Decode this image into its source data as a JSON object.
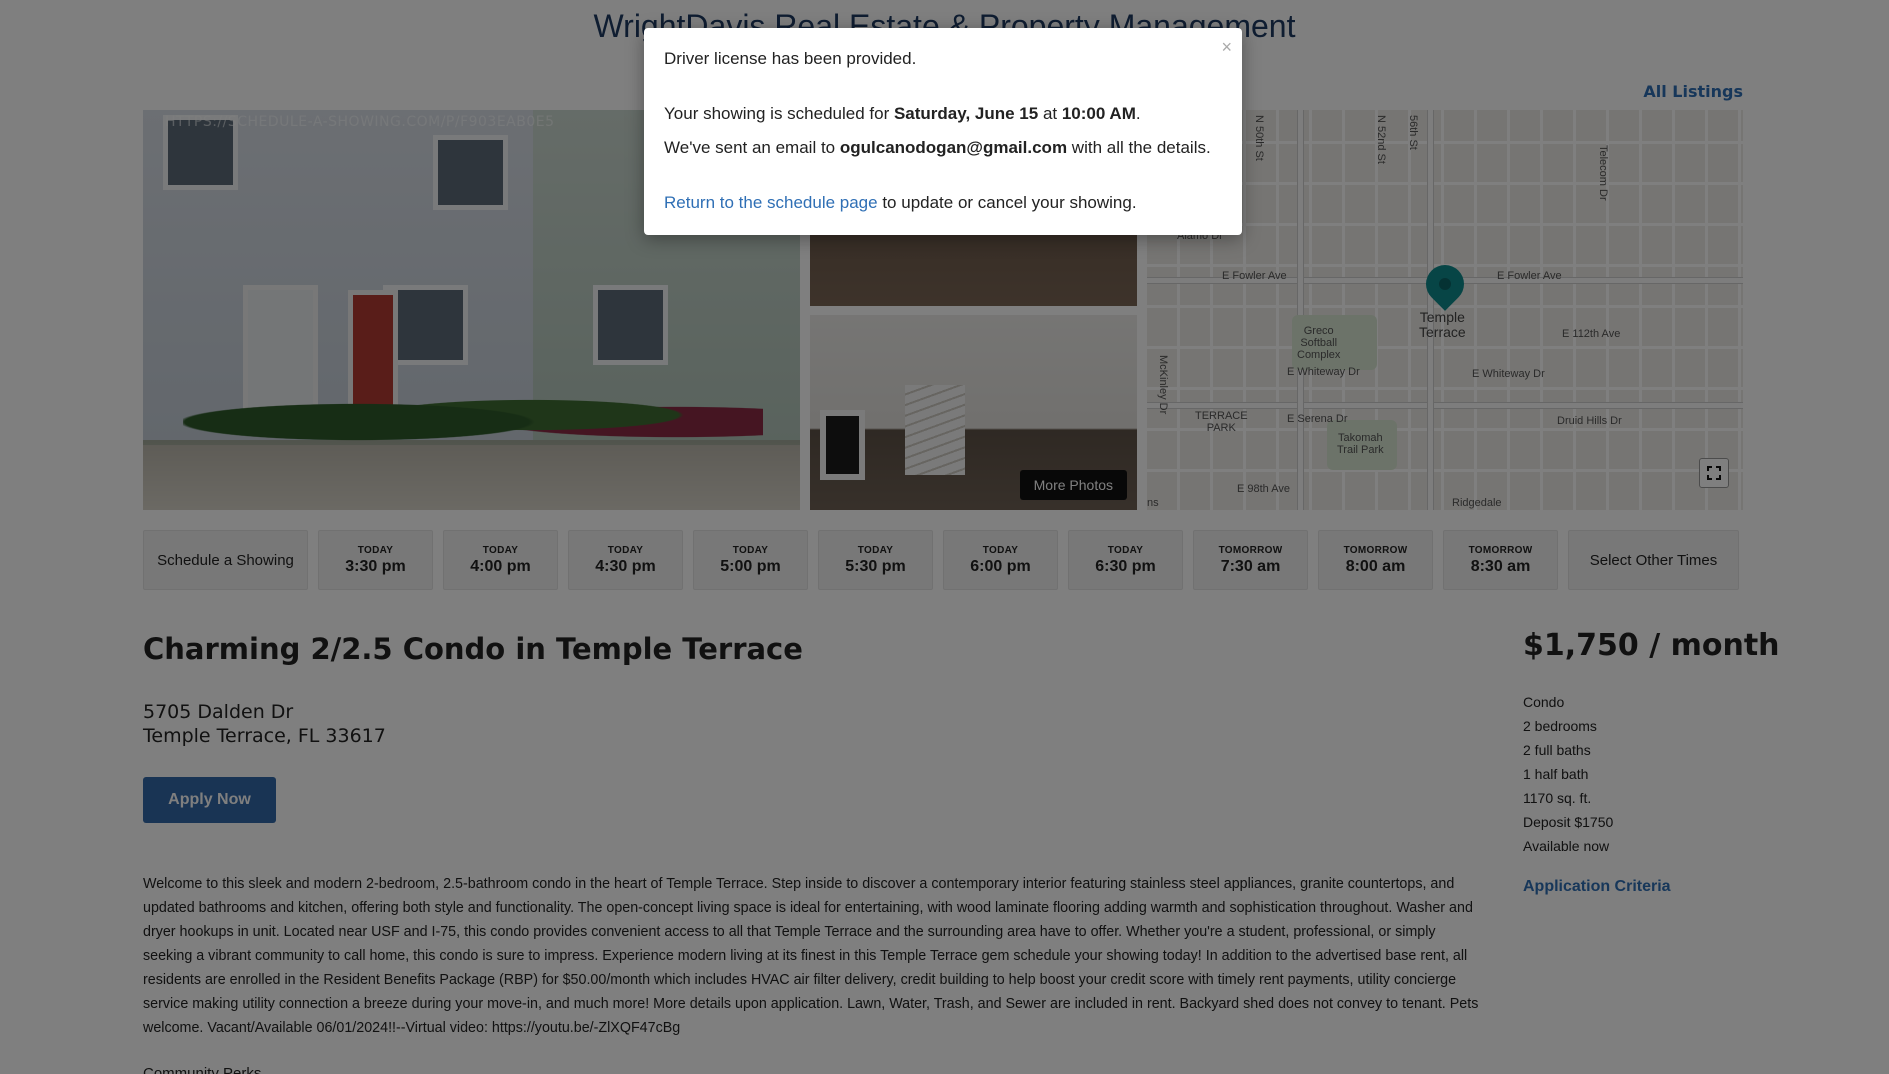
{
  "site": {
    "title": "WrightDavis Real Estate & Property Management",
    "all_listings": "All Listings"
  },
  "gallery": {
    "url_overlay": "HTTPS://SCHEDULE-A-SHOWING.COM/P/F903EAB0E5",
    "more_photos": "More Photos"
  },
  "map": {
    "labels": {
      "fowler_w": "E Fowler Ave",
      "fowler_e": "E Fowler Ave",
      "city": "Temple\nTerrace",
      "greco": "Greco\nSoftball\nComplex",
      "whiteway_w": "E Whiteway Dr",
      "whiteway_e": "E Whiteway Dr",
      "terrace_park": "TERRACE\nPARK",
      "serena": "E Serena Dr",
      "takomah": "Takomah\nTrail Park",
      "druid": "Druid Hills Dr",
      "ave98": "E 98th Ave",
      "ridgedale": "Ridgedale",
      "ave112": "E 112th Ave",
      "st56": "56th St",
      "st50": "N 50th St",
      "st52": "N 52nd St",
      "alamo": "Alamo Dr",
      "mckinley": "McKinley Dr",
      "telecom": "Telecom Dr",
      "ns": "ns"
    }
  },
  "times": {
    "schedule_label": "Schedule a Showing",
    "slots": [
      {
        "day": "TODAY",
        "time": "3:30 pm"
      },
      {
        "day": "TODAY",
        "time": "4:00 pm"
      },
      {
        "day": "TODAY",
        "time": "4:30 pm"
      },
      {
        "day": "TODAY",
        "time": "5:00 pm"
      },
      {
        "day": "TODAY",
        "time": "5:30 pm"
      },
      {
        "day": "TODAY",
        "time": "6:00 pm"
      },
      {
        "day": "TODAY",
        "time": "6:30 pm"
      },
      {
        "day": "TOMORROW",
        "time": "7:30 am"
      },
      {
        "day": "TOMORROW",
        "time": "8:00 am"
      },
      {
        "day": "TOMORROW",
        "time": "8:30 am"
      }
    ],
    "other_label": "Select Other Times"
  },
  "listing": {
    "title": "Charming 2/2.5 Condo in Temple Terrace",
    "address_line1": "5705 Dalden Dr",
    "address_line2": "Temple Terrace, FL 33617",
    "apply_label": "Apply Now",
    "description": "Welcome to this sleek and modern 2-bedroom, 2.5-bathroom condo in the heart of Temple Terrace. Step inside to discover a contemporary interior featuring stainless steel appliances, granite countertops, and updated bathrooms and kitchen, offering both style and functionality. The open-concept living space is ideal for entertaining, with wood laminate flooring adding warmth and sophistication throughout. Washer and dryer hookups in unit. Located near USF and I-75, this condo provides convenient access to all that Temple Terrace and the surrounding area have to offer. Whether you're a student, professional, or simply seeking a vibrant community to call home, this condo is sure to impress. Experience modern living at its finest in this Temple Terrace gem schedule your showing today! In addition to the advertised base rent, all residents are enrolled in the Resident Benefits Package (RBP) for $50.00/month which includes HVAC air filter delivery, credit building to help boost your credit score with timely rent payments, utility concierge service making utility connection a breeze during your move-in, and much more! More details upon application. Lawn, Water, Trash, and Sewer are included in rent. Backyard shed does not convey to tenant. Pets welcome. Vacant/Available 06/01/2024!!--Virtual video: https://youtu.be/-ZlXQF47cBg",
    "community_perks": "Community Perks"
  },
  "sidebar": {
    "price": "$1,750 / month",
    "facts": [
      "Condo",
      "2 bedrooms",
      "2 full baths",
      "1 half bath",
      "1170 sq. ft.",
      "Deposit $1750",
      "Available now"
    ],
    "app_criteria": "Application Criteria"
  },
  "modal": {
    "close_symbol": "×",
    "line1": "Driver license has been provided.",
    "line2_prefix": "Your showing is scheduled for ",
    "line2_date": "Saturday, June 15",
    "line2_mid": " at ",
    "line2_time": "10:00 AM",
    "line2_suffix": ".",
    "line3_prefix": "We've sent an email to ",
    "line3_email": "ogulcanodogan@gmail.com",
    "line3_suffix": " with all the details.",
    "line4_link": "Return to the schedule page",
    "line4_suffix": " to update or cancel your showing."
  },
  "colors": {
    "overlay": "rgba(0,0,0,0.5)",
    "link": "#2f6fb5",
    "apply_button": "#3268a8",
    "map_pin": "#0f8a8c"
  }
}
